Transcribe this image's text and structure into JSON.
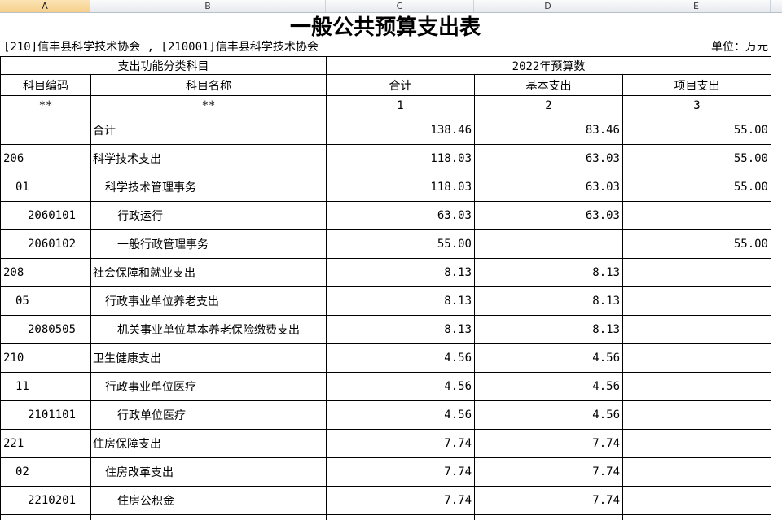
{
  "sheet": {
    "column_headers": [
      "A",
      "B",
      "C",
      "D",
      "E"
    ],
    "selected_column": "A"
  },
  "title": "一般公共预算支出表",
  "org_line": "[210]信丰县科学技术协会 , [210001]信丰县科学技术协会",
  "unit": "单位：万元",
  "header": {
    "group_left": "支出功能分类科目",
    "group_right": "2022年预算数",
    "columns": [
      "科目编码",
      "科目名称",
      "合计",
      "基本支出",
      "项目支出"
    ],
    "index_row": [
      "**",
      "**",
      "1",
      "2",
      "3"
    ]
  },
  "rows": [
    {
      "code": "",
      "name": "合计",
      "total": "138.46",
      "basic": "83.46",
      "project": "55.00"
    },
    {
      "code": "206",
      "name": "科学技术支出",
      "total": "118.03",
      "basic": "63.03",
      "project": "55.00"
    },
    {
      "code": "01",
      "name": "科学技术管理事务",
      "total": "118.03",
      "basic": "63.03",
      "project": "55.00"
    },
    {
      "code": "2060101",
      "name": "行政运行",
      "total": "63.03",
      "basic": "63.03",
      "project": ""
    },
    {
      "code": "2060102",
      "name": "一般行政管理事务",
      "total": "55.00",
      "basic": "",
      "project": "55.00"
    },
    {
      "code": "208",
      "name": "社会保障和就业支出",
      "total": "8.13",
      "basic": "8.13",
      "project": ""
    },
    {
      "code": "05",
      "name": "行政事业单位养老支出",
      "total": "8.13",
      "basic": "8.13",
      "project": ""
    },
    {
      "code": "2080505",
      "name": "机关事业单位基本养老保险缴费支出",
      "total": "8.13",
      "basic": "8.13",
      "project": ""
    },
    {
      "code": "210",
      "name": "卫生健康支出",
      "total": "4.56",
      "basic": "4.56",
      "project": ""
    },
    {
      "code": "11",
      "name": "行政事业单位医疗",
      "total": "4.56",
      "basic": "4.56",
      "project": ""
    },
    {
      "code": "2101101",
      "name": "行政单位医疗",
      "total": "4.56",
      "basic": "4.56",
      "project": ""
    },
    {
      "code": "221",
      "name": "住房保障支出",
      "total": "7.74",
      "basic": "7.74",
      "project": ""
    },
    {
      "code": "02",
      "name": "住房改革支出",
      "total": "7.74",
      "basic": "7.74",
      "project": ""
    },
    {
      "code": "2210201",
      "name": "住房公积金",
      "total": "7.74",
      "basic": "7.74",
      "project": ""
    }
  ],
  "colors": {
    "selected_column_header": "#f6d08a",
    "table_border": "#000000"
  }
}
